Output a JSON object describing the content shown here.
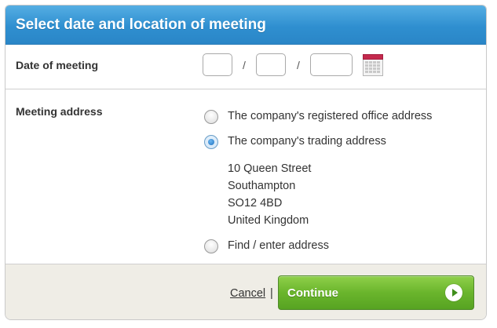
{
  "header": {
    "title": "Select date and location of meeting"
  },
  "date_row": {
    "label": "Date of meeting",
    "separator": "/",
    "day_value": "",
    "month_value": "",
    "year_value": ""
  },
  "address_row": {
    "label": "Meeting address",
    "options": [
      {
        "label": "The company's registered office address",
        "selected": false
      },
      {
        "label": "The company's trading address",
        "selected": true
      },
      {
        "label": "Find / enter address",
        "selected": false
      }
    ],
    "trading_address_lines": [
      "10 Queen Street",
      "Southampton",
      "SO12 4BD",
      "United Kingdom"
    ]
  },
  "footer": {
    "cancel_label": "Cancel",
    "separator": "|",
    "continue_label": "Continue"
  },
  "colors": {
    "header_blue": "#2f8fd0",
    "continue_green": "#6ab52c",
    "calendar_red": "#c4294d",
    "footer_bg": "#efede6"
  },
  "icons": {
    "calendar": "calendar-icon",
    "continue_arrow": "arrow-right-circle-icon"
  }
}
